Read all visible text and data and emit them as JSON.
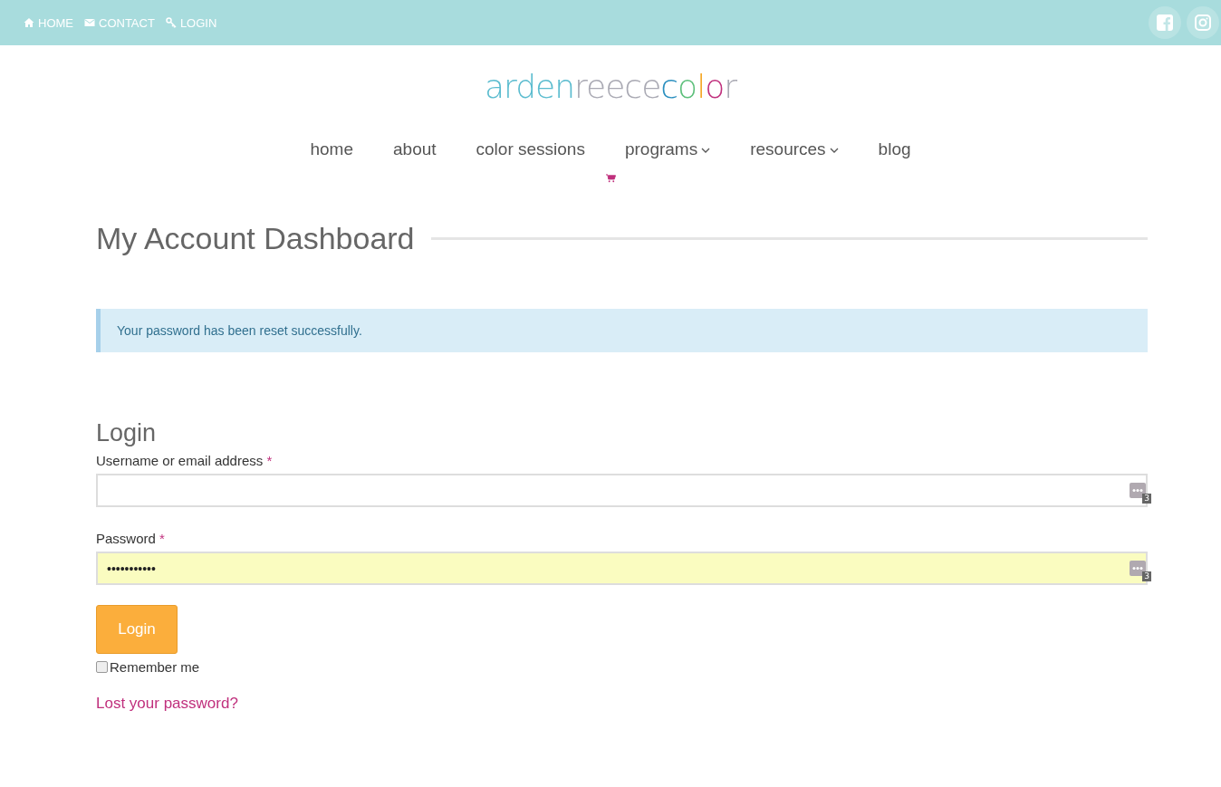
{
  "topbar": {
    "links": [
      {
        "label": "HOME"
      },
      {
        "label": "CONTACT"
      },
      {
        "label": "LOGIN"
      }
    ],
    "social": [
      {
        "kind": "facebook"
      },
      {
        "kind": "instagram"
      }
    ]
  },
  "logo": [
    {
      "text": "arden",
      "color": "#5bbccf"
    },
    {
      "text": "reece",
      "color": "#a9a9b3"
    },
    {
      "text": "c",
      "color": "#2a8fbf"
    },
    {
      "text": "o",
      "color": "#5cbf7a"
    },
    {
      "text": "l",
      "color": "#f5a623"
    },
    {
      "text": "o",
      "color": "#c0307d"
    },
    {
      "text": "r",
      "color": "#a9a9b3"
    }
  ],
  "nav": [
    {
      "label": "home",
      "dropdown": false
    },
    {
      "label": "about",
      "dropdown": false
    },
    {
      "label": "color sessions",
      "dropdown": false
    },
    {
      "label": "programs",
      "dropdown": true
    },
    {
      "label": "resources",
      "dropdown": true
    },
    {
      "label": "blog",
      "dropdown": false
    }
  ],
  "page_title": "My Account Dashboard",
  "notice": "Your password has been reset successfully.",
  "login": {
    "heading": "Login",
    "fields": [
      {
        "label": "Username or email address",
        "required_mark": "*",
        "autofilled": false,
        "badge": "3"
      },
      {
        "label": "Password",
        "required_mark": "*",
        "value": "•••••••••••",
        "autofilled": true,
        "badge": "3"
      }
    ],
    "button": "Login",
    "remember": {
      "label": "Remember me",
      "checked": false
    },
    "lost_link": "Lost your password?"
  }
}
